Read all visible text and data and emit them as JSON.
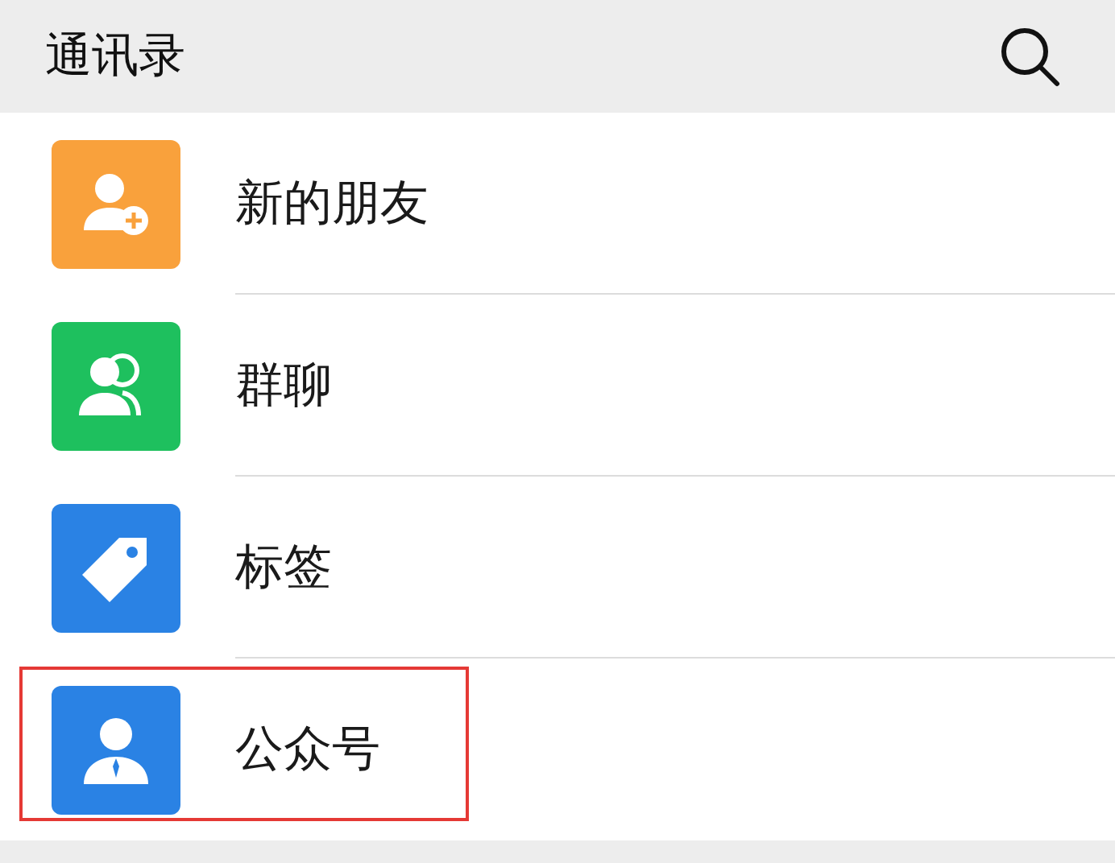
{
  "header": {
    "title": "通讯录"
  },
  "items": [
    {
      "label": "新的朋友",
      "kind": "new-friend",
      "color": "#f9a13c",
      "highlighted": false
    },
    {
      "label": "群聊",
      "kind": "group",
      "color": "#1ec05e",
      "highlighted": false
    },
    {
      "label": "标签",
      "kind": "tag",
      "color": "#2a82e4",
      "highlighted": false
    },
    {
      "label": "公众号",
      "kind": "official",
      "color": "#2a82e4",
      "highlighted": true
    }
  ]
}
